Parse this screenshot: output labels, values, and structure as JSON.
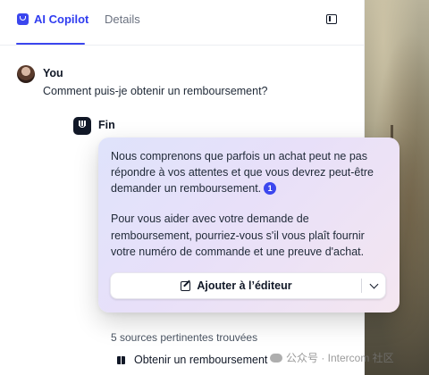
{
  "tabs": {
    "copilot_label": "AI Copilot",
    "details_label": "Details"
  },
  "conversation": {
    "user": {
      "name": "You",
      "message": "Comment puis-je obtenir un remboursement?"
    },
    "bot": {
      "name": "Fin",
      "paragraph1": "Nous comprenons que parfois un achat peut ne pas répondre à vos attentes et que vous devrez peut-être demander un remboursement.",
      "citation": "1",
      "paragraph2": "Pour vous aider avec votre demande de remboursement, pourriez-vous s'il vous plaît fournir votre numéro de commande et une preuve d'achat."
    }
  },
  "actions": {
    "add_to_editor_label": "Ajouter à l’éditeur"
  },
  "sources": {
    "title": "5 sources pertinentes trouvées",
    "items": [
      "Obtenir un remboursement"
    ]
  },
  "watermark": {
    "text": "公众号 · Intercom 社区"
  },
  "colors": {
    "accent": "#3b46ee",
    "text": "#111827",
    "card_gradient_start": "#dfe3fb",
    "card_gradient_end": "#f4e6f0"
  }
}
